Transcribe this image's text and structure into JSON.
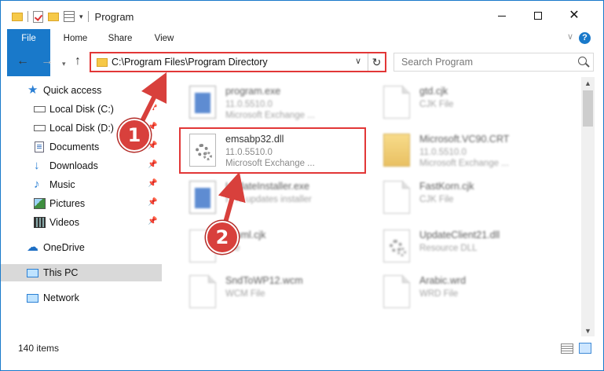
{
  "window": {
    "title": "Program",
    "controls": {
      "minimize": "minimize",
      "maximize": "maximize",
      "close": "✕"
    }
  },
  "ribbon": {
    "tabs": [
      "File",
      "Home",
      "Share",
      "View"
    ],
    "help": "?"
  },
  "address": {
    "path": "C:\\Program Files\\Program Directory",
    "search_placeholder": "Search Program"
  },
  "nav_pane": {
    "items": [
      {
        "label": "Quick access",
        "icon": "star-icon",
        "pinned": false
      },
      {
        "label": "Local Disk (C:)",
        "icon": "disk-icon",
        "pinned": true
      },
      {
        "label": "Local Disk (D:)",
        "icon": "disk-icon",
        "pinned": true
      },
      {
        "label": "Documents",
        "icon": "documents-icon",
        "pinned": true
      },
      {
        "label": "Downloads",
        "icon": "download-icon",
        "pinned": true
      },
      {
        "label": "Music",
        "icon": "music-icon",
        "pinned": true
      },
      {
        "label": "Pictures",
        "icon": "pictures-icon",
        "pinned": true
      },
      {
        "label": "Videos",
        "icon": "videos-icon",
        "pinned": true
      },
      {
        "label": "OneDrive",
        "icon": "cloud-icon",
        "pinned": false
      },
      {
        "label": "This PC",
        "icon": "computer-icon",
        "pinned": false,
        "selected": true
      },
      {
        "label": "Network",
        "icon": "network-icon",
        "pinned": false
      }
    ]
  },
  "files": [
    {
      "name": "program.exe",
      "line1": "11.0.5510.0",
      "line2": "Microsoft Exchange ...",
      "icon": "exe-icon",
      "blurred": true
    },
    {
      "name": "gtd.cjk",
      "line1": "CJK File",
      "line2": "",
      "icon": "page-icon",
      "blurred": true
    },
    {
      "name": "emsabp32.dll",
      "line1": "11.0.5510.0",
      "line2": "Microsoft Exchange ...",
      "icon": "gear-file-icon",
      "blurred": false
    },
    {
      "name": "Microsoft.VC90.CRT",
      "line1": "11.0.5510.0",
      "line2": "Microsoft Exchange ...",
      "icon": "folder-icon",
      "blurred": true
    },
    {
      "name": "UpdateInstaller.exe",
      "line1": "EXY updates installer",
      "line2": "",
      "icon": "exe-icon",
      "blurred": true
    },
    {
      "name": "FastKorn.cjk",
      "line1": "CJK File",
      "line2": "",
      "icon": "page-icon",
      "blurred": true
    },
    {
      "name": "xlmml.cjk",
      "line1": "File",
      "line2": "",
      "icon": "page-icon",
      "blurred": true
    },
    {
      "name": "UpdateClient21.dll",
      "line1": "Resource DLL",
      "line2": "",
      "icon": "gear-file-icon",
      "blurred": true
    },
    {
      "name": "SndToWP12.wcm",
      "line1": "WCM File",
      "line2": "",
      "icon": "page-icon",
      "blurred": true
    },
    {
      "name": "Arabic.wrd",
      "line1": "WRD File",
      "line2": "",
      "icon": "page-icon",
      "blurred": true
    }
  ],
  "status": {
    "item_count": "140 items"
  },
  "annotations": {
    "step1": "1",
    "step2": "2",
    "accent": "#d8403c"
  },
  "colors": {
    "highlight_border": "#e23737",
    "file_tab": "#1979ca"
  }
}
